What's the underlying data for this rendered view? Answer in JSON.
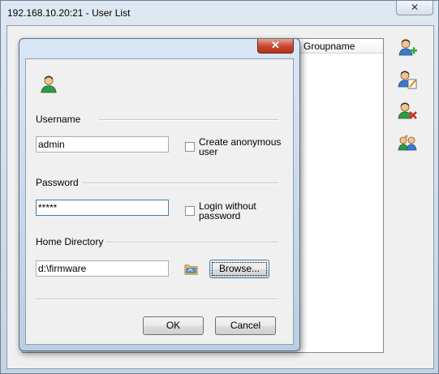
{
  "window": {
    "title": "192.168.10.20:21 - User List",
    "close_glyph": "✕"
  },
  "list": {
    "columns": [
      "Groupname"
    ]
  },
  "side_icons": [
    "add-user-icon",
    "edit-user-icon",
    "delete-user-icon",
    "users-group-icon"
  ],
  "dialog": {
    "close_glyph": "✕",
    "icon": "user-icon",
    "username": {
      "label": "Username",
      "value": "admin",
      "anonymous_label": "Create anonymous user",
      "anonymous_checked": false
    },
    "password": {
      "label": "Password",
      "value": "*****",
      "no_password_label": "Login without password",
      "no_password_checked": false
    },
    "home": {
      "label": "Home Directory",
      "value": "d:\\firmware",
      "browse_label": "Browse...",
      "folder_icon": "folder-icon"
    },
    "ok_label": "OK",
    "cancel_label": "Cancel"
  }
}
